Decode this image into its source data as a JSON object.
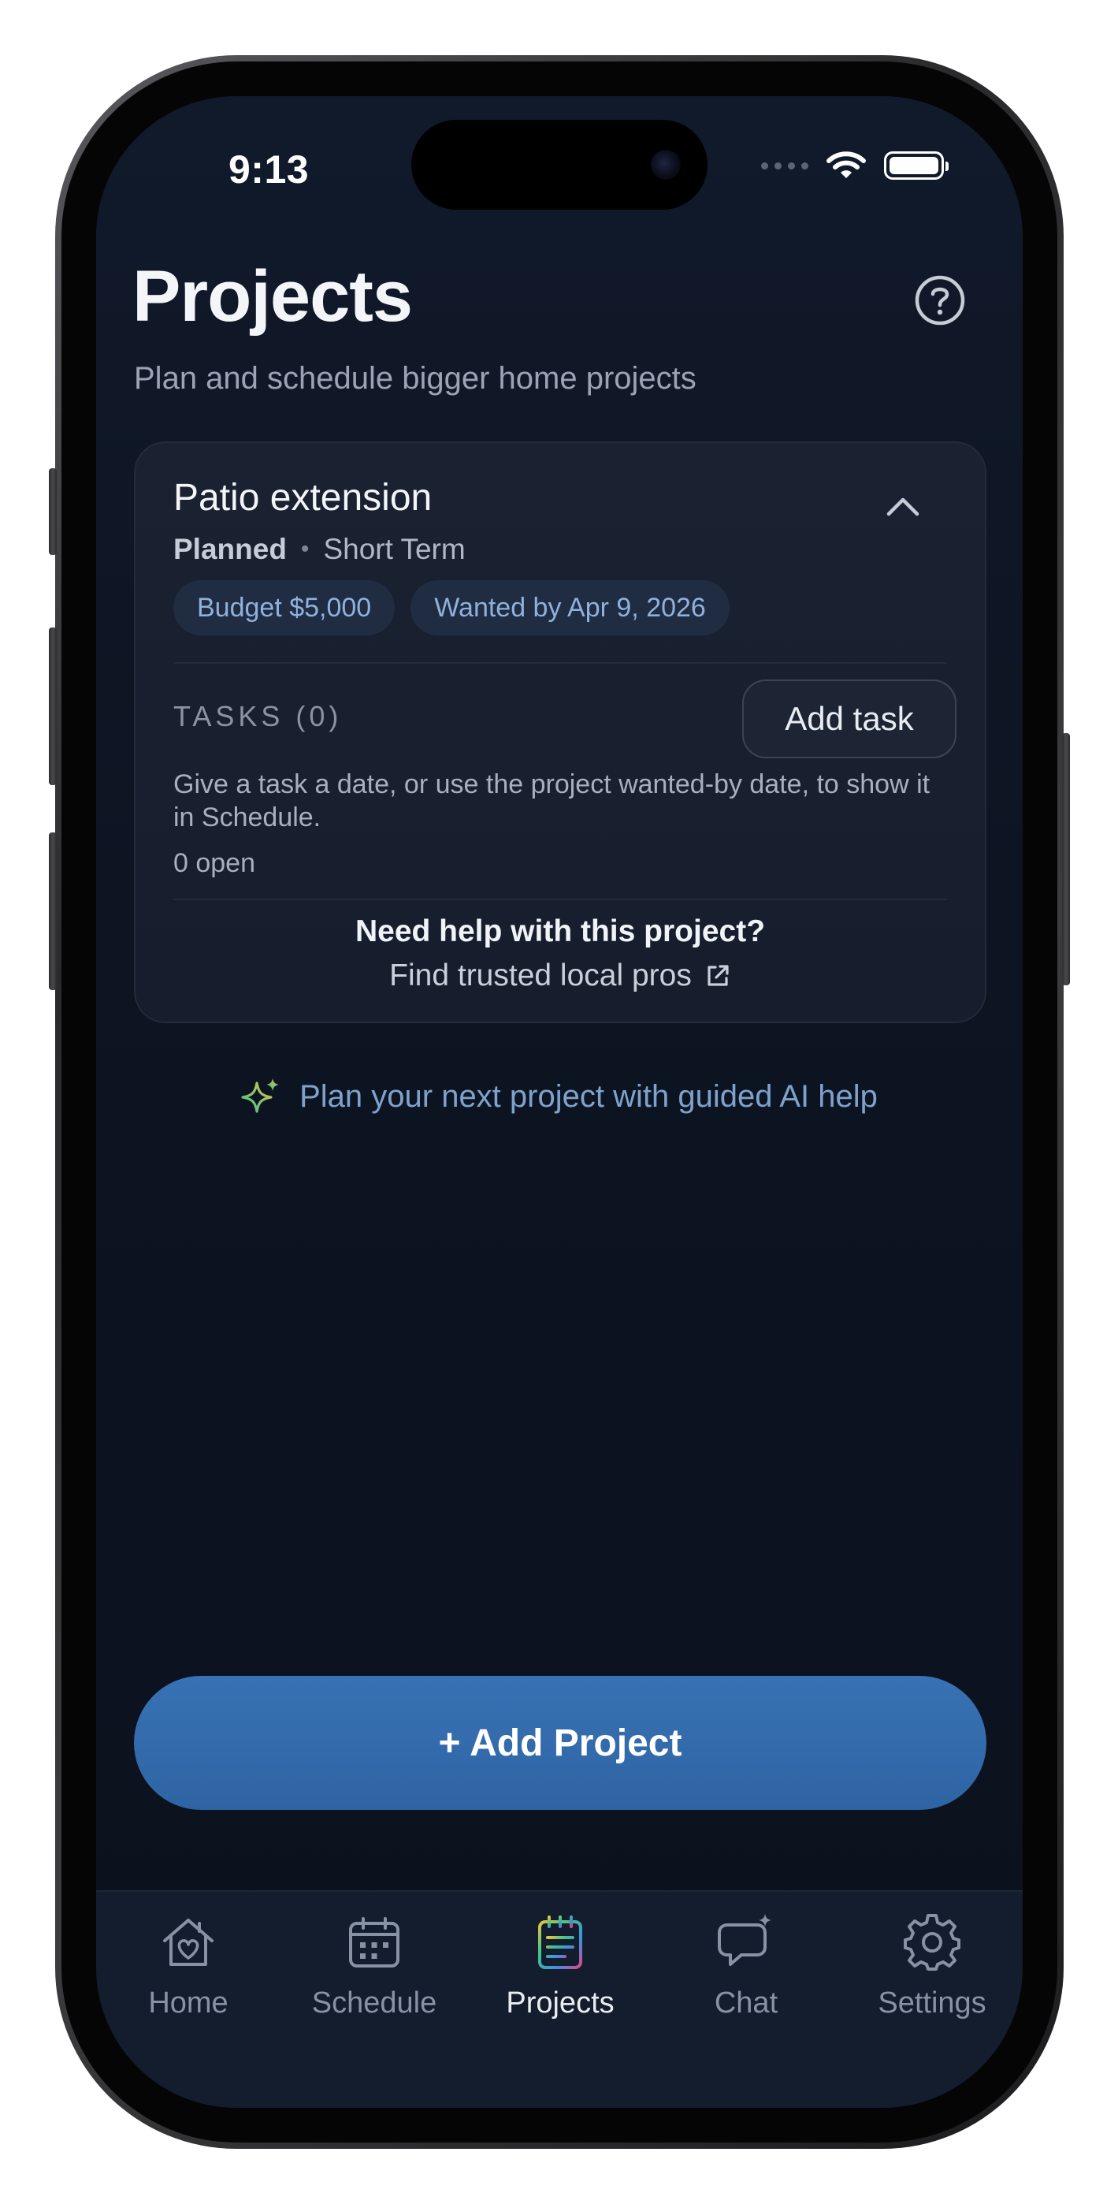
{
  "status_bar": {
    "time": "9:13"
  },
  "header": {
    "title": "Projects",
    "subtitle": "Plan and schedule bigger home projects",
    "help_icon": "question-circle-icon"
  },
  "project": {
    "title": "Patio extension",
    "status": "Planned",
    "term": "Short Term",
    "chips": [
      "Budget $5,000",
      "Wanted by Apr 9, 2026"
    ],
    "tasks_label": "TASKS (0)",
    "add_task_label": "Add task",
    "tasks_help": "Give a task a date, or use the project wanted-by date, to show it in Schedule.",
    "open_count": "0 open",
    "help_heading": "Need help with this project?",
    "pros_link": "Find trusted local pros"
  },
  "ai_help": {
    "label": "Plan your next project with guided AI help",
    "icon": "sparkle-icon"
  },
  "add_project_label": "+ Add Project",
  "tabs": [
    {
      "label": "Home",
      "icon": "house-heart-icon",
      "active": false
    },
    {
      "label": "Schedule",
      "icon": "calendar-icon",
      "active": false
    },
    {
      "label": "Projects",
      "icon": "notepad-icon",
      "active": true
    },
    {
      "label": "Chat",
      "icon": "chat-sparkle-icon",
      "active": false
    },
    {
      "label": "Settings",
      "icon": "gear-icon",
      "active": false
    }
  ],
  "colors": {
    "background": "#0d1422",
    "card": "#1a2232",
    "accent": "#3872b4",
    "chip_text": "#8fb1dc",
    "link": "#7fa2cc"
  }
}
